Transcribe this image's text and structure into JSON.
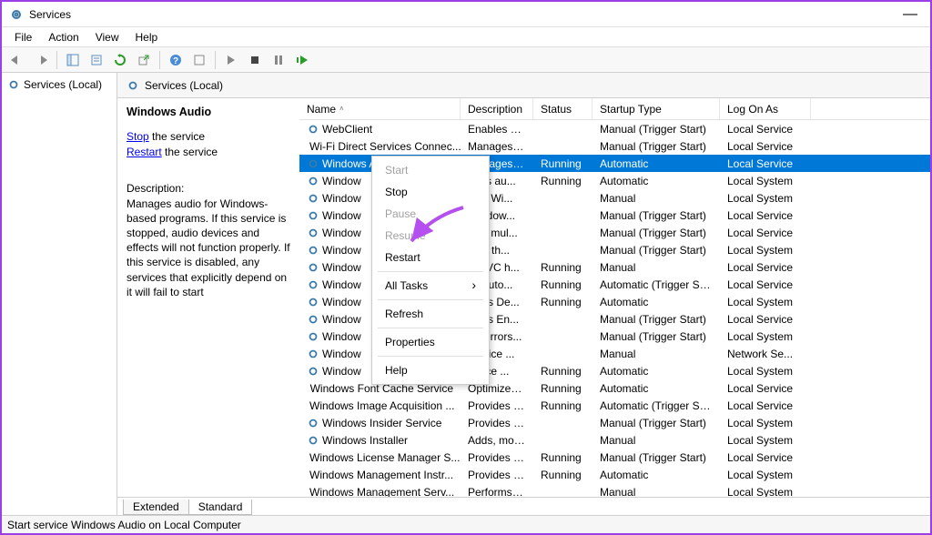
{
  "window": {
    "title": "Services",
    "minimize": "—"
  },
  "menubar": [
    "File",
    "Action",
    "View",
    "Help"
  ],
  "nav": {
    "item": "Services (Local)"
  },
  "content_header": "Services (Local)",
  "details": {
    "name": "Windows Audio",
    "stop_link": "Stop",
    "stop_suffix": " the service",
    "restart_link": "Restart",
    "restart_suffix": " the service",
    "desc_label": "Description:",
    "desc_text": "Manages audio for Windows-based programs.  If this service is stopped, audio devices and effects will not function properly.  If this service is disabled, any services that explicitly depend on it will fail to start"
  },
  "columns": {
    "name": "Name",
    "desc": "Description",
    "status": "Status",
    "startup": "Startup Type",
    "logon": "Log On As"
  },
  "rows": [
    {
      "name": "WebClient",
      "desc": "Enables Win...",
      "status": "",
      "startup": "Manual (Trigger Start)",
      "logon": "Local Service"
    },
    {
      "name": "Wi-Fi Direct Services Connec...",
      "desc": "Manages co...",
      "status": "",
      "startup": "Manual (Trigger Start)",
      "logon": "Local Service"
    },
    {
      "name": "Windows Audio",
      "desc": "Manages au...",
      "status": "Running",
      "startup": "Automatic",
      "logon": "Local Service",
      "selected": true
    },
    {
      "name": "Window",
      "desc": "ages au...",
      "status": "Running",
      "startup": "Automatic",
      "logon": "Local System"
    },
    {
      "name": "Window",
      "desc": "ides Wi...",
      "status": "",
      "startup": "Manual",
      "logon": "Local System"
    },
    {
      "name": "Window",
      "desc": "Window...",
      "status": "",
      "startup": "Manual (Trigger Start)",
      "logon": "Local Service"
    },
    {
      "name": "Window",
      "desc": "bles mul...",
      "status": "",
      "startup": "Manual (Trigger Start)",
      "logon": "Local Service"
    },
    {
      "name": "Window",
      "desc": "itors th...",
      "status": "",
      "startup": "Manual (Trigger Start)",
      "logon": "Local System"
    },
    {
      "name": "Window",
      "desc": "ICSVC h...",
      "status": "Running",
      "startup": "Manual",
      "logon": "Local Service"
    },
    {
      "name": "Window",
      "desc": "es auto...",
      "status": "Running",
      "startup": "Automatic (Trigger Start)",
      "logon": "Local Service"
    },
    {
      "name": "Window",
      "desc": "dows De...",
      "status": "Running",
      "startup": "Automatic",
      "logon": "Local System"
    },
    {
      "name": "Window",
      "desc": "dows En...",
      "status": "",
      "startup": "Manual (Trigger Start)",
      "logon": "Local Service"
    },
    {
      "name": "Window",
      "desc": "ws errors...",
      "status": "",
      "startup": "Manual (Trigger Start)",
      "logon": "Local System"
    },
    {
      "name": "Window",
      "desc": "service ...",
      "status": "",
      "startup": "Manual",
      "logon": "Network Se..."
    },
    {
      "name": "Window",
      "desc": "ervice ...",
      "status": "Running",
      "startup": "Automatic",
      "logon": "Local System"
    },
    {
      "name": "Windows Font Cache Service",
      "desc": "Optimizes p...",
      "status": "Running",
      "startup": "Automatic",
      "logon": "Local Service"
    },
    {
      "name": "Windows Image Acquisition ...",
      "desc": "Provides ima...",
      "status": "Running",
      "startup": "Automatic (Trigger Start)",
      "logon": "Local Service"
    },
    {
      "name": "Windows Insider Service",
      "desc": "Provides infr...",
      "status": "",
      "startup": "Manual (Trigger Start)",
      "logon": "Local System"
    },
    {
      "name": "Windows Installer",
      "desc": "Adds, modifi...",
      "status": "",
      "startup": "Manual",
      "logon": "Local System"
    },
    {
      "name": "Windows License Manager S...",
      "desc": "Provides infr...",
      "status": "Running",
      "startup": "Manual (Trigger Start)",
      "logon": "Local Service"
    },
    {
      "name": "Windows Management Instr...",
      "desc": "Provides a c...",
      "status": "Running",
      "startup": "Automatic",
      "logon": "Local System"
    },
    {
      "name": "Windows Management Serv...",
      "desc": "Performs ma...",
      "status": "",
      "startup": "Manual",
      "logon": "Local System"
    }
  ],
  "context_menu": {
    "start": "Start",
    "stop": "Stop",
    "pause": "Pause",
    "resume": "Resume",
    "restart": "Restart",
    "all_tasks": "All Tasks",
    "refresh": "Refresh",
    "properties": "Properties",
    "help": "Help"
  },
  "tabs": {
    "extended": "Extended",
    "standard": "Standard"
  },
  "statusbar": "Start service Windows Audio on Local Computer"
}
